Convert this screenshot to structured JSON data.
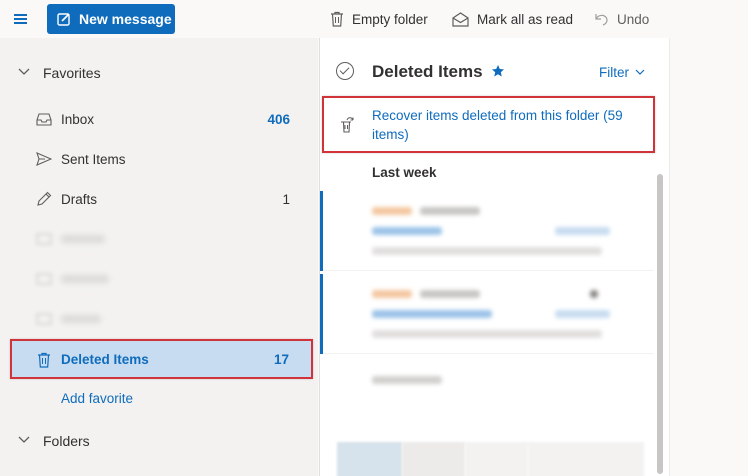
{
  "toolbar": {
    "new_message": "New message",
    "empty_folder": "Empty folder",
    "mark_all_read": "Mark all as read",
    "undo": "Undo"
  },
  "nav": {
    "favorites_label": "Favorites",
    "items": [
      {
        "label": "Inbox",
        "count": "406",
        "icon": "inbox-icon"
      },
      {
        "label": "Sent Items",
        "count": "",
        "icon": "send-icon"
      },
      {
        "label": "Drafts",
        "count": "1",
        "icon": "pencil-icon"
      },
      {
        "label": "Deleted Items",
        "count": "17",
        "icon": "trash-icon"
      }
    ],
    "add_favorite": "Add favorite",
    "folders_label": "Folders"
  },
  "list": {
    "title": "Deleted Items",
    "filter": "Filter",
    "recover_text": "Recover items deleted from this folder (59 items)",
    "section_last_week": "Last week"
  },
  "colors": {
    "accent": "#0f6cbd",
    "highlight_border": "#d13438",
    "selected_bg": "#c7dcf0"
  }
}
